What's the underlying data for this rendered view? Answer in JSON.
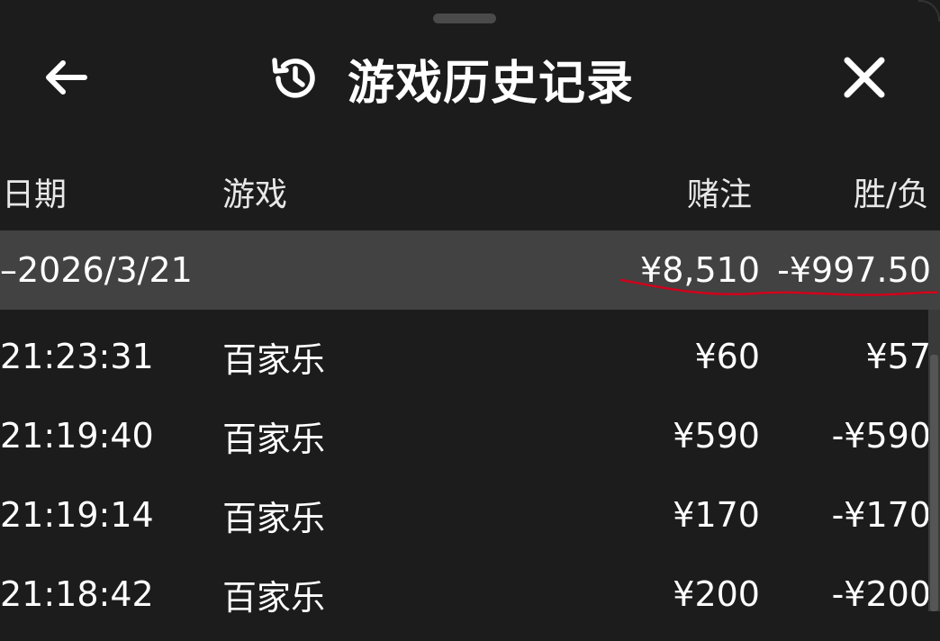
{
  "header": {
    "title": "游戏历史记录",
    "back_icon": "arrow-left-icon",
    "history_icon": "history-clock-icon",
    "close_icon": "close-icon"
  },
  "columns": {
    "date": "日期",
    "game": "游戏",
    "bet": "赌注",
    "result": "胜/负"
  },
  "summary": {
    "date": "–2026/3/21",
    "bet": "¥8,510",
    "result": "-¥997.50",
    "highlight_color": "#d0021b"
  },
  "rows": [
    {
      "time": "21:23:31",
      "game": "百家乐",
      "bet": "¥60",
      "result": "¥57"
    },
    {
      "time": "21:19:40",
      "game": "百家乐",
      "bet": "¥590",
      "result": "-¥590"
    },
    {
      "time": "21:19:14",
      "game": "百家乐",
      "bet": "¥170",
      "result": "-¥170"
    },
    {
      "time": "21:18:42",
      "game": "百家乐",
      "bet": "¥200",
      "result": "-¥200"
    }
  ],
  "colors": {
    "background": "#1c1c1c",
    "summary_row": "#424242",
    "text": "#ffffff"
  }
}
